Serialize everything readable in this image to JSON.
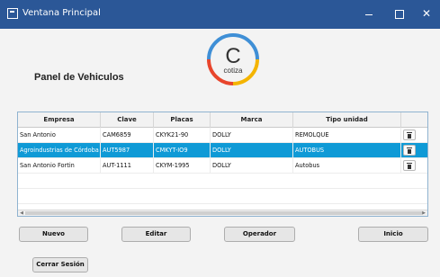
{
  "window": {
    "title": "Ventana Principal",
    "minimize": "",
    "maximize": "",
    "close": "✕"
  },
  "logo": {
    "letter": "C",
    "text": "cotiza",
    "colors": [
      "#3f8fd6",
      "#f4b400",
      "#e8452c",
      "#3f8fd6"
    ]
  },
  "panel_title": "Panel de Vehiculos",
  "table": {
    "headers": [
      "Empresa",
      "Clave",
      "Placas",
      "Marca",
      "Tipo unidad",
      ""
    ],
    "rows": [
      {
        "empresa": "San Antonio",
        "clave": "CAM6859",
        "placas": "CKYK21-90",
        "marca": "DOLLY",
        "tipo": "REMOLQUE",
        "selected": false
      },
      {
        "empresa": "Agroindustrias de Córdoba",
        "clave": "AUT5987",
        "placas": "CMKYT-IO9",
        "marca": "DOLLY",
        "tipo": "AUTOBUS",
        "selected": true
      },
      {
        "empresa": "San Antonio Fortin",
        "clave": "AUT-1111",
        "placas": "CKYM-1995",
        "marca": "DOLLY",
        "tipo": "Autobus",
        "selected": false
      }
    ]
  },
  "buttons": {
    "nuevo": "Nuevo",
    "editar": "Editar",
    "operador": "Operador",
    "inicio": "Inicio",
    "cerrar_sesion": "Cerrar Sesión"
  },
  "colors": {
    "titlebar": "#2b5797",
    "selection": "#0f9ad6"
  }
}
